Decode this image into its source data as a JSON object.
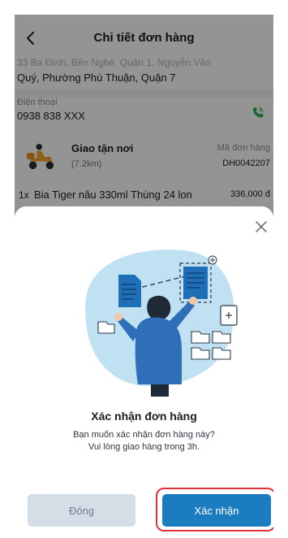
{
  "header": {
    "title": "Chi tiết đơn hàng"
  },
  "address": {
    "partial_line": "33 Ba Đình, Bến Nghé, Quận 1, Nguyễn Văn",
    "line": "Quý, Phường Phú Thuận, Quận 7"
  },
  "contact": {
    "label": "Điện thoại",
    "value": "0938 838 XXX"
  },
  "shipping": {
    "method": "Giao tận nơi",
    "distance": "(7.2km)",
    "order_label": "Mã đơn hàng",
    "order_id": "DH0042207"
  },
  "item": {
    "qty": "1x",
    "name": "Bia Tiger nâu 330ml Thùng 24 lon",
    "price": "336,000 đ"
  },
  "dialog": {
    "title": "Xác nhận đơn hàng",
    "line1": "Bạn muốn xác nhận đơn hàng này?",
    "line2": "Vui lòng giao hàng trong 3h.",
    "cancel_label": "Đóng",
    "confirm_label": "Xác nhận"
  },
  "colors": {
    "accent": "#1b7cc0",
    "highlight": "#e0303a",
    "call": "#2bb24c"
  },
  "icons": [
    "back-arrow-icon",
    "phone-call-icon",
    "delivery-scooter-icon",
    "close-icon"
  ]
}
